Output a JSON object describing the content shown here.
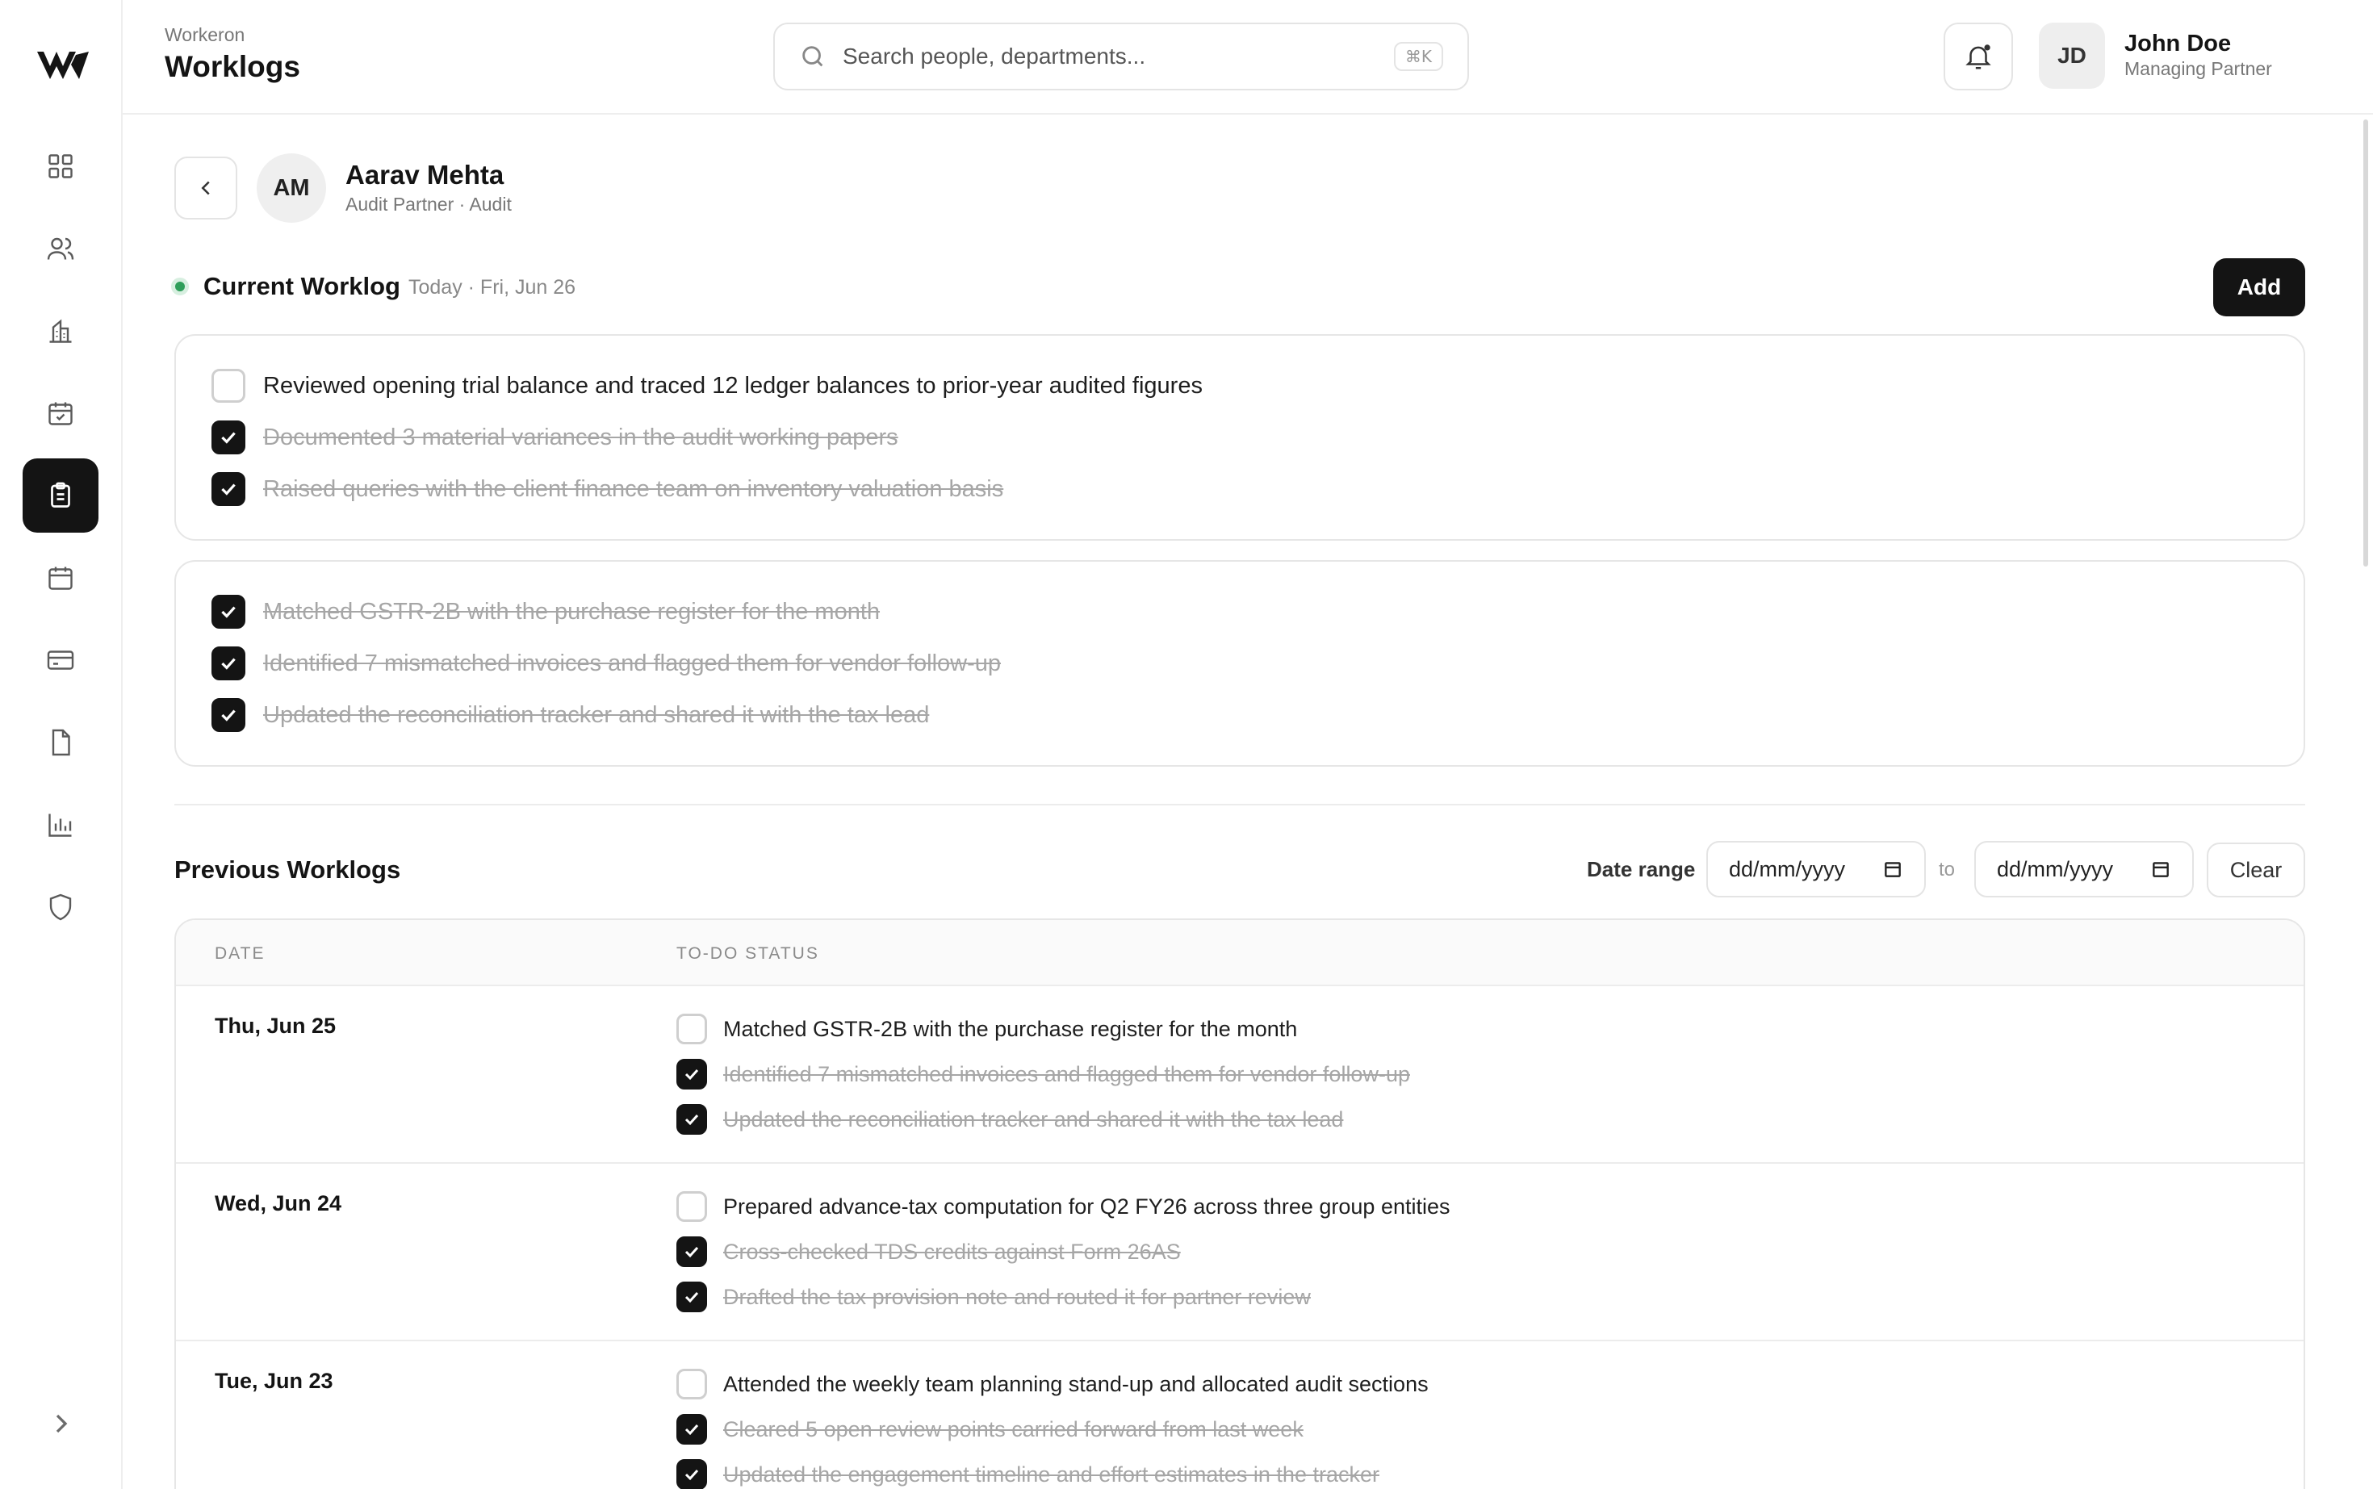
{
  "app": {
    "name": "Workeron",
    "page_title": "Worklogs"
  },
  "search": {
    "placeholder": "Search people, departments...",
    "shortcut": "⌘K"
  },
  "user": {
    "initials": "JD",
    "name": "John Doe",
    "role": "Managing Partner"
  },
  "sidebar": {
    "items": [
      {
        "icon": "dashboard-icon",
        "active": false
      },
      {
        "icon": "users-icon",
        "active": false
      },
      {
        "icon": "building-icon",
        "active": false
      },
      {
        "icon": "calendar-check-icon",
        "active": false
      },
      {
        "icon": "clipboard-icon",
        "active": true
      },
      {
        "icon": "calendar-icon",
        "active": false
      },
      {
        "icon": "credit-card-icon",
        "active": false
      },
      {
        "icon": "document-icon",
        "active": false
      },
      {
        "icon": "bar-chart-icon",
        "active": false
      },
      {
        "icon": "shield-icon",
        "active": false
      }
    ]
  },
  "person": {
    "initials": "AM",
    "name": "Aarav Mehta",
    "role": "Audit Partner · Audit"
  },
  "current": {
    "title": "Current Worklog",
    "date": "Today · Fri, Jun 26",
    "add_label": "Add",
    "groups": [
      {
        "tasks": [
          {
            "text": "Reviewed opening trial balance and traced 12 ledger balances to prior-year audited figures",
            "done": false
          },
          {
            "text": "Documented 3 material variances in the audit working papers",
            "done": true
          },
          {
            "text": "Raised queries with the client finance team on inventory valuation basis",
            "done": true
          }
        ]
      },
      {
        "tasks": [
          {
            "text": "Matched GSTR-2B with the purchase register for the month",
            "done": true
          },
          {
            "text": "Identified 7 mismatched invoices and flagged them for vendor follow-up",
            "done": true
          },
          {
            "text": "Updated the reconciliation tracker and shared it with the tax lead",
            "done": true
          }
        ]
      }
    ]
  },
  "previous": {
    "title": "Previous Worklogs",
    "date_range_label": "Date range",
    "from_placeholder": "dd/mm/yyyy",
    "to_label": "to",
    "to_placeholder": "dd/mm/yyyy",
    "clear_label": "Clear",
    "columns": [
      "DATE",
      "TO-DO STATUS"
    ],
    "rows": [
      {
        "date": "Thu, Jun 25",
        "tasks": [
          {
            "text": "Matched GSTR-2B with the purchase register for the month",
            "done": false
          },
          {
            "text": "Identified 7 mismatched invoices and flagged them for vendor follow-up",
            "done": true
          },
          {
            "text": "Updated the reconciliation tracker and shared it with the tax lead",
            "done": true
          }
        ]
      },
      {
        "date": "Wed, Jun 24",
        "tasks": [
          {
            "text": "Prepared advance-tax computation for Q2 FY26 across three group entities",
            "done": false
          },
          {
            "text": "Cross-checked TDS credits against Form 26AS",
            "done": true
          },
          {
            "text": "Drafted the tax provision note and routed it for partner review",
            "done": true
          }
        ]
      },
      {
        "date": "Tue, Jun 23",
        "tasks": [
          {
            "text": "Attended the weekly team planning stand-up and allocated audit sections",
            "done": false
          },
          {
            "text": "Cleared 5 open review points carried forward from last week",
            "done": true
          },
          {
            "text": "Updated the engagement timeline and effort estimates in the tracker",
            "done": true
          }
        ]
      }
    ]
  }
}
